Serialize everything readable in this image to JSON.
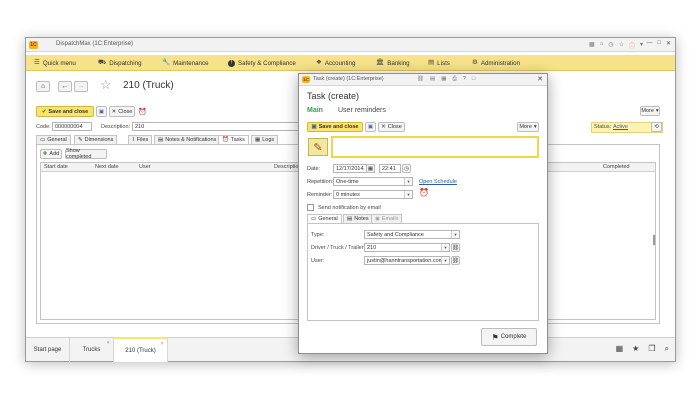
{
  "window": {
    "title": "DispatchMax (1C:Enterprise)"
  },
  "menu": {
    "items": [
      {
        "label": "Quick menu",
        "icon": "hamburger-icon"
      },
      {
        "label": "Dispatching",
        "icon": "truck-icon"
      },
      {
        "label": "Maintenance",
        "icon": "wrench-icon"
      },
      {
        "label": "Safety & Compliance",
        "icon": "exclamation-icon"
      },
      {
        "label": "Accounting",
        "icon": "money-icon"
      },
      {
        "label": "Banking",
        "icon": "bank-icon"
      },
      {
        "label": "Lists",
        "icon": "lists-icon"
      },
      {
        "label": "Administration",
        "icon": "gear-icon"
      }
    ]
  },
  "form": {
    "title": "210 (Truck)",
    "save_close": "Save and close",
    "close": "Close",
    "more": "More",
    "code_label": "Code:",
    "code_value": "000000004",
    "description_label": "Description:",
    "description_value": "210",
    "status_label": "Status:",
    "status_value": "Active",
    "tabs": [
      "General",
      "Dimensions",
      "Files",
      "Notes & Notifications",
      "Tasks",
      "Logs"
    ],
    "add_label": "Add",
    "show_completed": "Show completed",
    "columns": [
      "Start date",
      "Next date",
      "User",
      "Description",
      "Completed"
    ]
  },
  "dialog": {
    "title": "Task (create) (1C:Enterprise)",
    "heading": "Task (create)",
    "tab_main": "Main",
    "tab_reminders": "User reminders",
    "save_close": "Save and close",
    "close": "Close",
    "more": "More",
    "date_label": "Date:",
    "date_value": "12/17/2014",
    "time_value": "22:41",
    "repetition_label": "Repetition:",
    "repetition_value": "One-time",
    "open_schedule": "Open Schedule",
    "reminder_label": "Reminder:",
    "reminder_value": "0 minutes",
    "send_email": "Send notification by email",
    "subtabs": [
      "General",
      "Notes",
      "Emails"
    ],
    "type_label": "Type:",
    "type_value": "Safety and Compliance",
    "driver_label": "Driver / Truck / Trailer:",
    "driver_value": "210",
    "user_label": "User:",
    "user_value": "justin@hanntransportation.com",
    "complete": "Complete"
  },
  "taskbar": {
    "tabs": [
      "Start page",
      "Trucks",
      "210 (Truck)"
    ]
  },
  "colors": {
    "menu_bg": "#f7e28a",
    "accent_yellow": "#fbe469",
    "main_green": "#3a9a50",
    "link_blue": "#2a5db0"
  }
}
